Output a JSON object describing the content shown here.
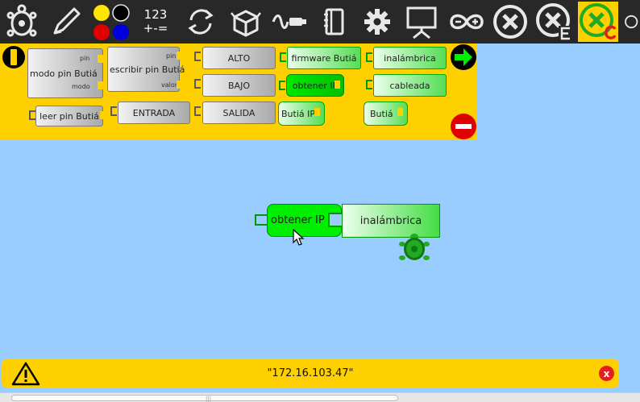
{
  "toolbar": {
    "numbers_label": "123\n+-=",
    "buttons": [
      {
        "icon": "turtle-icon"
      },
      {
        "icon": "pen-icon"
      },
      {
        "icon": "colors-icon"
      },
      {
        "icon": "numbers-icon"
      },
      {
        "icon": "flow-icon"
      },
      {
        "icon": "box-icon"
      },
      {
        "icon": "sensor-icon"
      },
      {
        "icon": "notebook-icon"
      },
      {
        "icon": "gear-icon"
      },
      {
        "icon": "presentation-icon"
      },
      {
        "icon": "arduino-icon"
      },
      {
        "icon": "stop-icon"
      },
      {
        "icon": "stop-e-icon"
      },
      {
        "icon": "stop-c-icon",
        "active": true
      }
    ]
  },
  "palette": {
    "modo_pin": "modo pin Butiá",
    "modo_pin_arg1": "pin",
    "modo_pin_arg2": "modo",
    "escribir_pin": "escribir pin Butiá",
    "escribir_pin_arg1": "pin",
    "escribir_pin_arg2": "valor",
    "leer_pin": "leer pin Butiá",
    "alto": "ALTO",
    "bajo": "BAJO",
    "entrada": "ENTRADA",
    "salida": "SALIDA",
    "firmware": "firmware Butiá",
    "obtener_ip": "obtener IP",
    "butia_ip": "Butiá IP",
    "inalambrica": "inalámbrica",
    "cableada": "cableada",
    "butia": "Butiá"
  },
  "canvas": {
    "obtener_ip": "obtener IP",
    "inalambrica": "inalámbrica"
  },
  "status": {
    "text": "\"172.16.103.47\""
  },
  "colors": {
    "toolbar_bg": "#282828",
    "accent": "#ffd000",
    "canvas_bg": "#99ccff",
    "block_green": "#00ee00"
  }
}
